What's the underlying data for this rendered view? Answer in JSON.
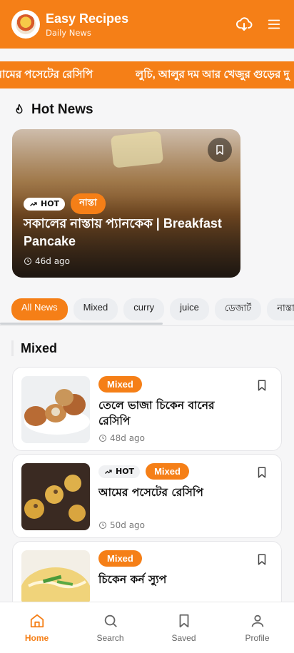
{
  "header": {
    "title": "Easy Recipes",
    "subtitle": "Daily News"
  },
  "ticker": {
    "items": [
      "আমের পসেটের রেসিপি",
      "লুচি, আলুর দম আর খেজুর গুড়ের দু"
    ]
  },
  "hot_news": {
    "heading": "Hot News",
    "featured": {
      "hot_label": "HOT",
      "category": "নাস্তা",
      "title": "সকালের নাস্তায় প্যানকেক | Breakfast Pancake",
      "time": "46d ago"
    }
  },
  "filters": [
    "All News",
    "Mixed",
    "curry",
    "juice",
    "ডেজার্ট",
    "নাস্তা"
  ],
  "section": {
    "title": "Mixed"
  },
  "cards": [
    {
      "category": "Mixed",
      "hot": "",
      "title": "তেলে ভাজা চিকেন বানের রেসিপি",
      "time": "48d ago"
    },
    {
      "category": "Mixed",
      "hot": "HOT",
      "title": "আমের পসেটের রেসিপি",
      "time": "50d ago"
    },
    {
      "category": "Mixed",
      "hot": "",
      "title": "চিকেন কর্ন স্যুপ",
      "time": ""
    }
  ],
  "nav": {
    "home": "Home",
    "search": "Search",
    "saved": "Saved",
    "profile": "Profile"
  },
  "colors": {
    "accent": "#f57f17"
  }
}
